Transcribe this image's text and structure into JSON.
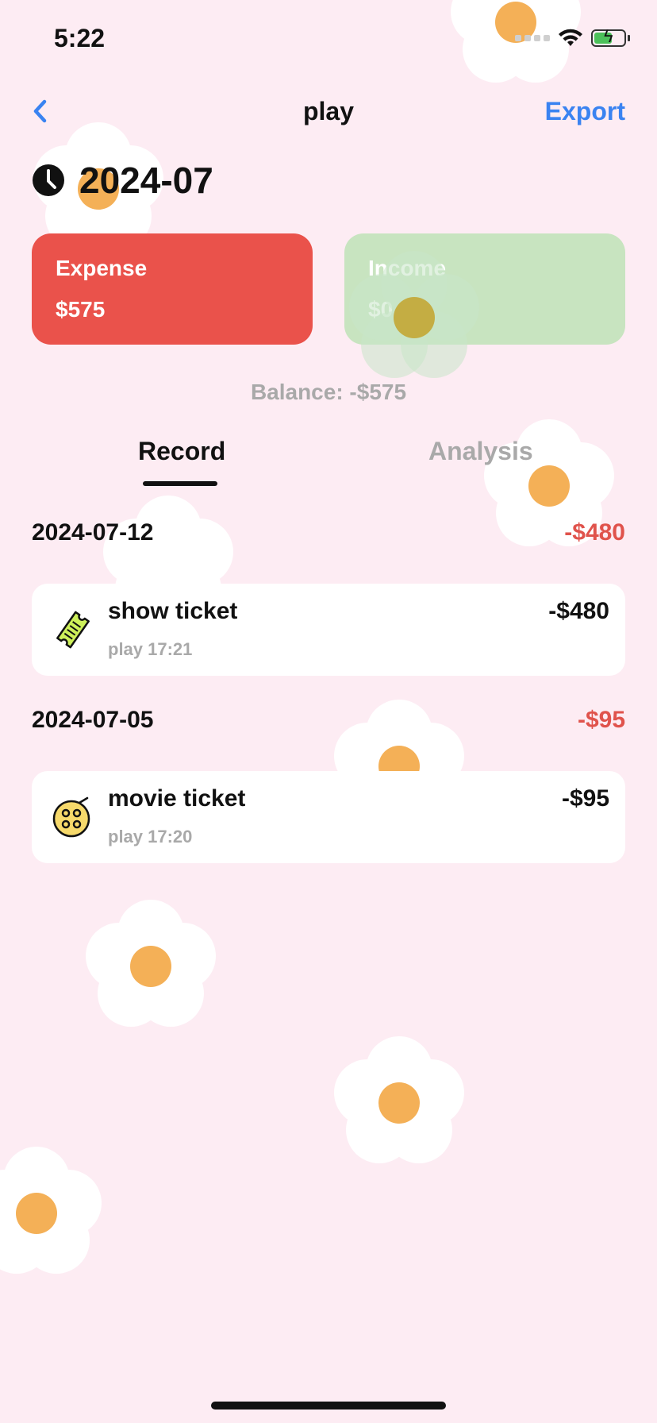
{
  "status_bar": {
    "time": "5:22"
  },
  "nav": {
    "back_icon": "chevron-left-icon",
    "title": "play",
    "export_label": "Export"
  },
  "period": {
    "icon": "clock-icon",
    "label": "2024-07"
  },
  "summary": {
    "expense": {
      "label": "Expense",
      "value": "$575",
      "color": "#ea524b"
    },
    "income": {
      "label": "Income",
      "value": "$0",
      "color": "#c8e4c0"
    },
    "balance": "Balance: -$575"
  },
  "tabs": {
    "record": "Record",
    "analysis": "Analysis",
    "active": "record"
  },
  "groups": [
    {
      "date": "2024-07-12",
      "total": "-$480",
      "items": [
        {
          "icon": "ticket-icon",
          "name": "show ticket",
          "meta": "play 17:21",
          "amount": "-$480"
        }
      ]
    },
    {
      "date": "2024-07-05",
      "total": "-$95",
      "items": [
        {
          "icon": "film-reel-icon",
          "name": "movie ticket",
          "meta": "play 17:20",
          "amount": "-$95"
        }
      ]
    }
  ],
  "colors": {
    "background": "#fdecf3",
    "accent": "#3a83f1",
    "negative": "#e0534c",
    "muted": "#a9a9a9"
  }
}
